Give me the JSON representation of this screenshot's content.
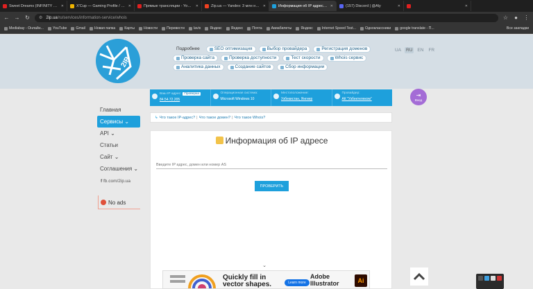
{
  "browser": {
    "tabs": [
      {
        "title": "Sweet Dreams (INFINITY BASS",
        "color": "#e02020"
      },
      {
        "title": "X'Cup — Gaming Profile / CLAY",
        "color": "#f0b400"
      },
      {
        "title": "Прямые трансляции - YouTube",
        "color": "#e02020"
      },
      {
        "title": "Zip.ua — Yandex: 3 млн найдено",
        "color": "#f04020"
      },
      {
        "title": "Информация об IP адресе - Whois",
        "color": "#1ea0dc"
      },
      {
        "title": "(157) Discord | @Aly",
        "color": "#5865f2"
      },
      {
        "title": "",
        "color": "#e02020"
      }
    ],
    "url_domain": "2ip.ua",
    "url_path": "/ru/services/information-service/whois",
    "bookmarks": [
      "Mediabay - Онлайн...",
      "YouTube",
      "Gmail",
      "Новая папка",
      "Карты",
      "Новости",
      "Перевести",
      "lavix",
      "Яндекс",
      "Яндекс",
      "Почта",
      "Авиабилеты",
      "Яндекс",
      "Internet Speed Test...",
      "Одноклассники",
      "google translate - П..."
    ],
    "bookmarks_right": "Все закладки"
  },
  "header": {
    "nav": [
      {
        "label": "Подробнее",
        "plain": true
      },
      {
        "label": "SEO оптимизация"
      },
      {
        "label": "Выбор провайдера"
      },
      {
        "label": "Регистрация доменов"
      },
      {
        "label": "Проверка сайта"
      },
      {
        "label": "Проверка доступности"
      },
      {
        "label": "Тест скорости"
      },
      {
        "label": "Whois сервис"
      },
      {
        "label": "Аналитика данных"
      },
      {
        "label": "Создание сайтов"
      },
      {
        "label": "Сбор информации"
      }
    ],
    "langs": [
      "UA",
      "RU",
      "EN",
      "FR"
    ],
    "active_lang": "RU"
  },
  "info": {
    "ip_label": "Ваш IP адрес:",
    "ip_value": "84.54.72.205",
    "check_label": "Проверка",
    "os_label": "Операционная система:",
    "os_value": "Microsoft Windows 10",
    "loc_label": "Местоположение:",
    "loc_value": "Узбекистан, Янгиер",
    "isp_label": "Провайдер:",
    "isp_value": "АК \"Узбектелеком\""
  },
  "login": {
    "label": "Вход"
  },
  "sidebar": {
    "items": [
      {
        "label": "Главная",
        "active": false,
        "arrow": ""
      },
      {
        "label": "Сервисы",
        "active": true,
        "arrow": "⌄"
      },
      {
        "label": "API",
        "active": false,
        "arrow": "⌄"
      },
      {
        "label": "Статьи",
        "active": false,
        "arrow": ""
      },
      {
        "label": "Сайт",
        "active": false,
        "arrow": "⌄"
      },
      {
        "label": "Соглашения",
        "active": false,
        "arrow": "⌄"
      }
    ],
    "fb": "fb.com/2ip.ua",
    "noads": "No ads"
  },
  "breadcrumb": [
    "Что такое IP-адрес?",
    "Что такое домен?",
    "Что такое Whois?"
  ],
  "main": {
    "title": "Информация об IP адресе",
    "input_placeholder": "Введите IP адрес, домен или номер AS",
    "submit": "ПРОВЕРИТЬ"
  },
  "ad": {
    "headline_1": "Quickly fill in",
    "headline_2": "vector shapes.",
    "cta": "Learn more",
    "brand_1": "Adobe",
    "brand_2": "Illustrator",
    "logo": "Ai"
  }
}
